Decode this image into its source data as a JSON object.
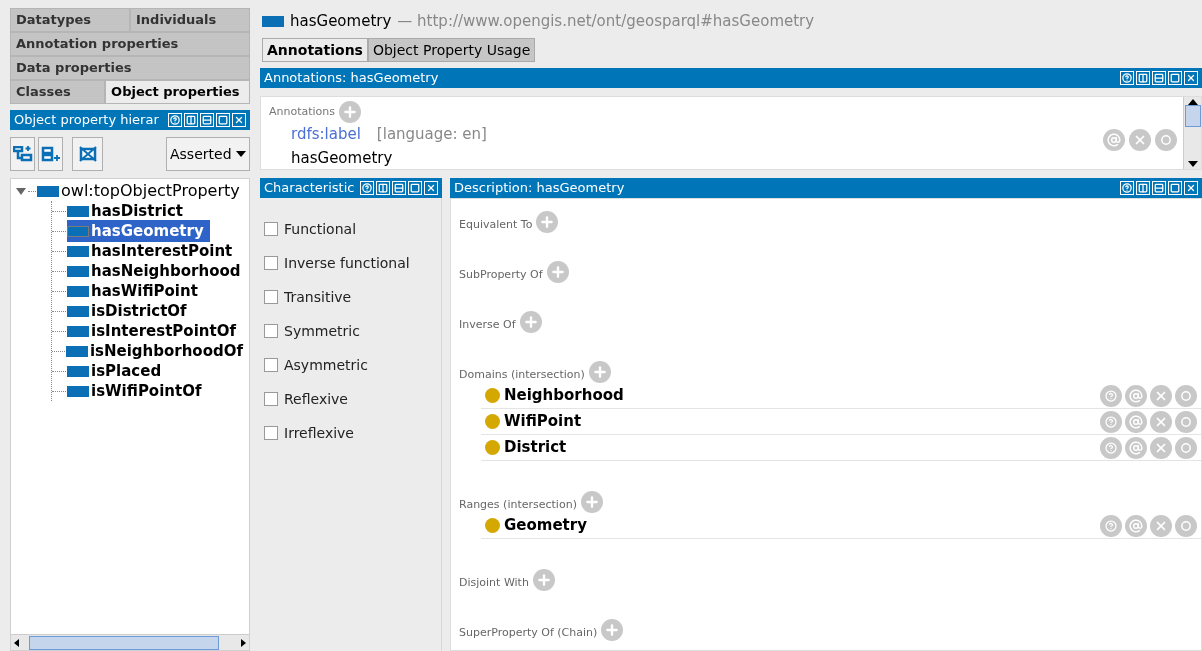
{
  "entity_tabs": [
    [
      {
        "label": "Datatypes",
        "selected": false
      },
      {
        "label": "Individuals",
        "selected": false
      }
    ],
    [
      {
        "label": "Annotation properties",
        "selected": false
      }
    ],
    [
      {
        "label": "Data properties",
        "selected": false
      }
    ],
    [
      {
        "label": "Classes",
        "selected": false
      },
      {
        "label": "Object properties",
        "selected": true
      }
    ]
  ],
  "hierarchy": {
    "title": "Object property hierar",
    "mode": "Asserted",
    "tree": [
      {
        "label": "owl:topObjectProperty",
        "selected": false,
        "expanded": true,
        "children": [
          {
            "label": "hasDistrict",
            "selected": false
          },
          {
            "label": "hasGeometry",
            "selected": true
          },
          {
            "label": "hasInterestPoint",
            "selected": false
          },
          {
            "label": "hasNeighborhood",
            "selected": false
          },
          {
            "label": "hasWifiPoint",
            "selected": false
          },
          {
            "label": "isDistrictOf",
            "selected": false
          },
          {
            "label": "isInterestPointOf",
            "selected": false
          },
          {
            "label": "isNeighborhoodOf",
            "selected": false
          },
          {
            "label": "isPlaced",
            "selected": false
          },
          {
            "label": "isWifiPointOf",
            "selected": false
          }
        ]
      }
    ]
  },
  "entity": {
    "name": "hasGeometry",
    "separator": "—",
    "iri": "http://www.opengis.net/ont/geosparql#hasGeometry"
  },
  "tabs": [
    {
      "label": "Annotations",
      "selected": true
    },
    {
      "label": "Object Property Usage",
      "selected": false
    }
  ],
  "annotations": {
    "title": "Annotations: hasGeometry",
    "section": "Annotations",
    "items": [
      {
        "property": "rdfs:label",
        "language": "[language: en]",
        "value": "hasGeometry"
      }
    ]
  },
  "characteristics": {
    "title": "Characteristic",
    "items": [
      {
        "label": "Functional",
        "checked": false
      },
      {
        "label": "Inverse functional",
        "checked": false
      },
      {
        "label": "Transitive",
        "checked": false
      },
      {
        "label": "Symmetric",
        "checked": false
      },
      {
        "label": "Asymmetric",
        "checked": false
      },
      {
        "label": "Reflexive",
        "checked": false
      },
      {
        "label": "Irreflexive",
        "checked": false
      }
    ]
  },
  "description": {
    "title": "Description: hasGeometry",
    "sections": [
      {
        "label": "Equivalent To"
      },
      {
        "label": "SubProperty Of"
      },
      {
        "label": "Inverse Of"
      },
      {
        "label": "Domains (intersection)",
        "items": [
          "Neighborhood",
          "WifiPoint",
          "District"
        ]
      },
      {
        "label": "Ranges (intersection)",
        "items": [
          "Geometry"
        ]
      },
      {
        "label": "Disjoint With"
      },
      {
        "label": "SuperProperty Of (Chain)"
      }
    ]
  }
}
